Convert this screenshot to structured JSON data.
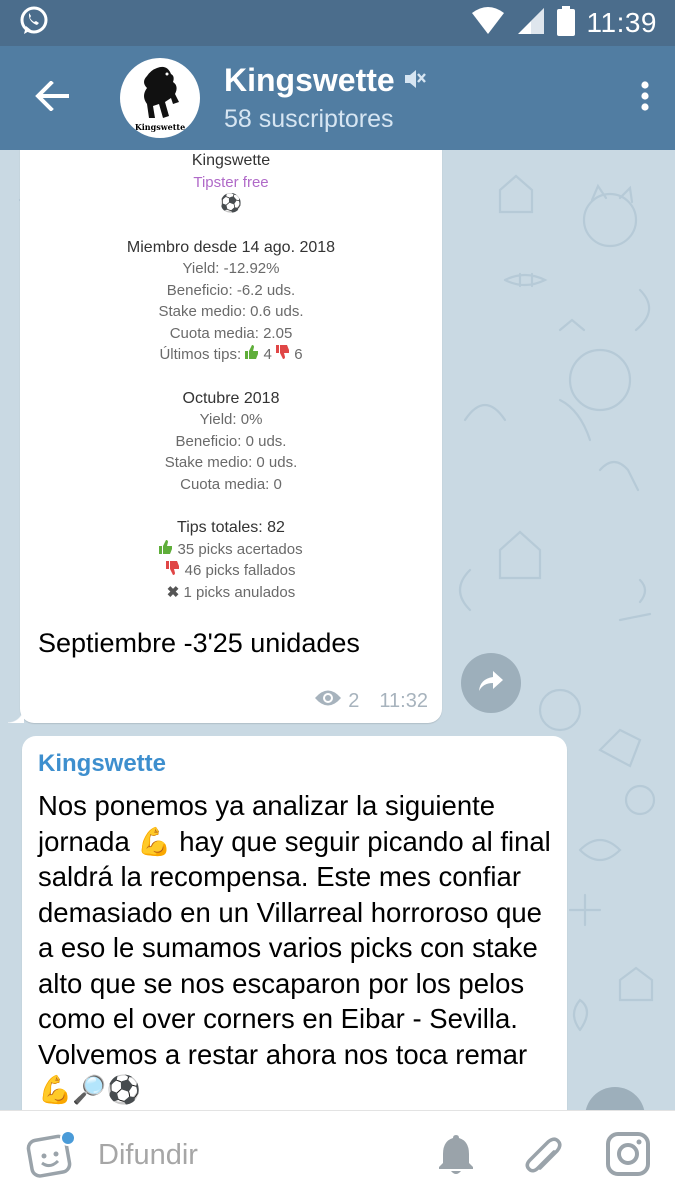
{
  "status_bar": {
    "time": "11:39",
    "icons": [
      "whatsapp-icon",
      "wifi-icon",
      "signal-icon",
      "battery-icon"
    ]
  },
  "header": {
    "channel_name": "Kingswette",
    "subscribers": "58 suscriptores",
    "avatar_caption": "Kingswette",
    "muted": true,
    "icons": [
      "back-arrow-icon",
      "muted-speaker-icon",
      "more-vert-icon"
    ]
  },
  "messages": [
    {
      "stats_card": {
        "name": "Kingswette",
        "tier": "Tipster free",
        "sport_icon": "⚽",
        "member_since": "Miembro desde 14 ago. 2018",
        "overall": {
          "yield": "Yield: -12.92%",
          "profit": "Beneficio: -6.2 uds.",
          "avg_stake": "Stake medio: 0.6 uds.",
          "avg_odds": "Cuota media: 2.05",
          "last_tips_label": "Últimos tips:",
          "last_tips_won": "4",
          "last_tips_lost": "6"
        },
        "month": {
          "title": "Octubre 2018",
          "yield": "Yield: 0%",
          "profit": "Beneficio: 0 uds.",
          "avg_stake": "Stake medio: 0 uds.",
          "avg_odds": "Cuota media: 0"
        },
        "totals": {
          "title": "Tips totales: 82",
          "won": "35 picks acertados",
          "lost": "46 picks fallados",
          "void": "1 picks anulados"
        }
      },
      "text": "Septiembre -3'25 unidades",
      "views": "2",
      "time": "11:32"
    },
    {
      "sender": "Kingswette",
      "text": "Nos ponemos ya analizar la siguiente jornada 💪 hay que seguir picando al final saldrá la recompensa. Este mes confiar demasiado en un Villarreal horroroso que a eso le sumamos varios picks con stake alto que se nos escaparon por los pelos como el over corners en Eibar - Sevilla. Volvemos a restar ahora nos toca remar 💪🔎⚽"
    }
  ],
  "composer": {
    "placeholder": "Difundir",
    "icons": [
      "sticker-icon",
      "bell-icon",
      "paperclip-icon",
      "instagram-icon"
    ]
  },
  "colors": {
    "status_bar": "#4b6d8c",
    "header": "#517da2",
    "chat_background": "#c9d9e3",
    "sender_name": "#3e8fce",
    "tier_label": "#b06ac8"
  }
}
